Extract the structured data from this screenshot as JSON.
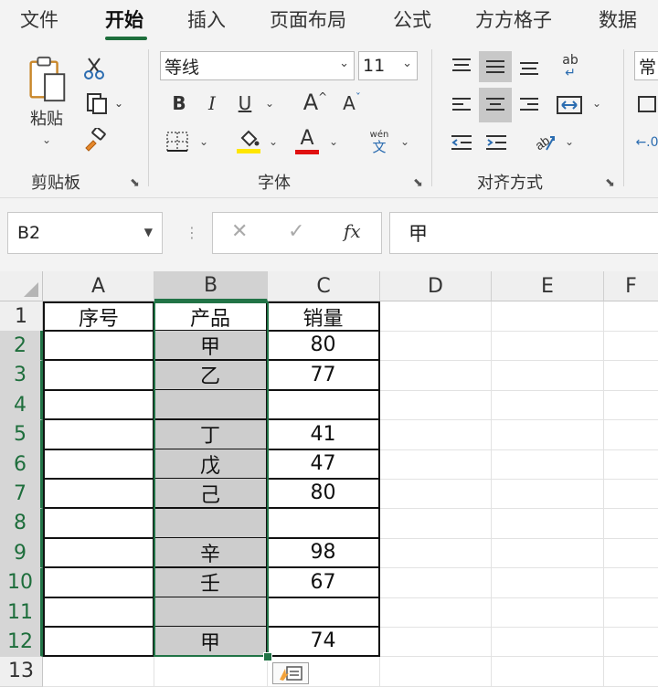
{
  "menu": {
    "tabs": [
      "文件",
      "开始",
      "插入",
      "页面布局",
      "公式",
      "方方格子",
      "数据"
    ],
    "active_tab": "开始"
  },
  "ribbon": {
    "clipboard": {
      "paste_label": "粘贴",
      "group_label": "剪贴板",
      "icons": [
        "paste-icon",
        "cut-icon",
        "copy-icon",
        "format-painter-icon"
      ]
    },
    "font": {
      "font_name": "等线",
      "font_size": "11",
      "bold": "B",
      "italic": "I",
      "underline": "U",
      "grow": "A",
      "shrink": "A",
      "font_color_letter": "A",
      "phonetic_top": "wén",
      "phonetic_bottom": "文",
      "group_label": "字体",
      "font_color": "#e01010",
      "highlight_color": "#ffe600"
    },
    "alignment": {
      "group_label": "对齐方式",
      "wrap_text_glyph": "ab"
    },
    "number": {
      "format_partial": "常"
    }
  },
  "formula_bar": {
    "name_box": "B2",
    "cancel": "✕",
    "enter": "✓",
    "fx": "fx",
    "value": "甲"
  },
  "sheet": {
    "columns": [
      "A",
      "B",
      "C",
      "D",
      "E",
      "F"
    ],
    "selected_column": "B",
    "rows": [
      "1",
      "2",
      "3",
      "4",
      "5",
      "6",
      "7",
      "8",
      "9",
      "10",
      "11",
      "12",
      "13"
    ],
    "selected_rows": [
      "2",
      "3",
      "4",
      "5",
      "6",
      "7",
      "8",
      "9",
      "10",
      "11",
      "12"
    ],
    "headers": {
      "A": "序号",
      "B": "产品",
      "C": "销量"
    },
    "data": [
      {
        "row": "2",
        "A": "",
        "B": "甲",
        "C": "80"
      },
      {
        "row": "3",
        "A": "",
        "B": "乙",
        "C": "77"
      },
      {
        "row": "4",
        "A": "",
        "B": "",
        "C": ""
      },
      {
        "row": "5",
        "A": "",
        "B": "丁",
        "C": "41"
      },
      {
        "row": "6",
        "A": "",
        "B": "戊",
        "C": "47"
      },
      {
        "row": "7",
        "A": "",
        "B": "己",
        "C": "80"
      },
      {
        "row": "8",
        "A": "",
        "B": "",
        "C": ""
      },
      {
        "row": "9",
        "A": "",
        "B": "辛",
        "C": "98"
      },
      {
        "row": "10",
        "A": "",
        "B": "壬",
        "C": "67"
      },
      {
        "row": "11",
        "A": "",
        "B": "",
        "C": ""
      },
      {
        "row": "12",
        "A": "",
        "B": "甲",
        "C": "74"
      }
    ],
    "accent_color": "#217346"
  }
}
